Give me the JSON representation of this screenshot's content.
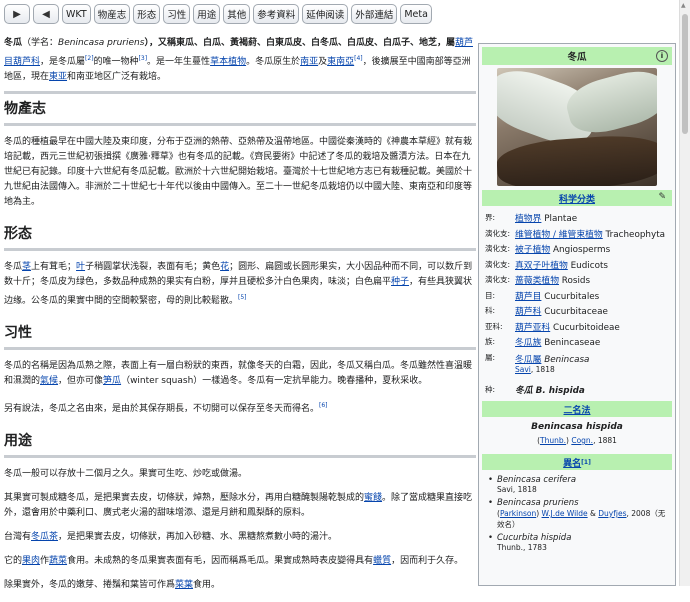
{
  "toolbar": {
    "back_arrow": "▶",
    "fwd_arrow": "◀",
    "buttons": [
      "WKT",
      "物産志",
      "形态",
      "习性",
      "用途",
      "其他",
      "参考資料",
      "延伸阅读",
      "外部連結",
      "Meta"
    ]
  },
  "article": {
    "intro": {
      "title_word": "冬瓜",
      "sci_pre": "（学名：",
      "sci_name": "Benincasa pruriens",
      "aliases": "），又稱東瓜、白瓜、黃褐葤、白東瓜皮、白冬瓜、白瓜皮、白瓜子、地芝，屬",
      "family_link": "葫芦目葫芦科",
      "mid": "，是冬瓜屬",
      "sup1": "[2]",
      "mid2": "的唯一物种",
      "sup2": "[3]",
      "mid3": "。是一年生蔓性",
      "herb_link": "草本植物",
      "mid4": "。冬瓜原生於",
      "sea_link": "南亚",
      "and": "及",
      "sea2_link": "東南亞",
      "sup3": "[4]",
      "mid5": "，後擴展至中國南部等亞洲地區，現在",
      "ea_link": "東亚",
      "end": "和南亚地区广泛有栽培。"
    },
    "sections": [
      {
        "heading": "物產志",
        "paras": [
          "冬瓜的種植最早在中國大陸及東印度，分布于亞洲的熱帶、亞熱帶及溫帶地區。中國從秦漢時的《神農本草經》就有栽培記載，西元三世紀初張揖撰《廣雅·釋草》也有冬瓜的記載。《齊民要術》中記述了冬瓜的栽培及醬漬方法。日本在九世紀已有記錄。印度十六世紀有冬瓜記載。歐洲於十六世紀開始栽培。臺灣於十七世紀地方志已有栽種記載。美國於十九世紀由法國傳入。非洲於二十世紀七十年代以後由中國傳入。至二十一世紀冬瓜栽培仍以中國大陸、東南亞和印度等地為主。"
        ]
      },
      {
        "heading": "形态",
        "p1": "冬瓜",
        "stem": "茎",
        "p2": "上有茸毛；",
        "leaf": "叶",
        "p3": "子稍圓掌状浅裂，表面有毛；黄色",
        "flower": "花",
        "p4": "；圆形、扁圆或长圆形果实，大小因品种而不同，可以数斤到数十斤；冬瓜皮为绿色，多数品种成熟的果实有白粉，厚并且硬松多汁白色果肉，味淡；白色扁平",
        "seed": "种子",
        "p5": "，有些具狭翼状边缘。公冬瓜的果實中間的空間較緊密，母的則比較鬆散。",
        "sup": "[5]"
      },
      {
        "heading": "习性",
        "p1": "冬瓜的名稱是因為瓜熟之際，表面上有一層白粉狀的東西，就像冬天的白霜，因此，冬瓜又稱白瓜。冬瓜雖然性喜溫暖和濕潤的",
        "climate": "氣候",
        "p2": "，但亦可像",
        "squash": "笋瓜",
        "p3": "（winter squash）一樣過冬。冬瓜有一定抗旱能力。晚春播种，夏秋采收。",
        "p4": "另有說法，冬瓜之名由來，是由於其保存期長，不切開可以保存至冬天而得名。",
        "sup": "[6]"
      },
      {
        "heading": "用途",
        "p1": "冬瓜一般可以存放十二個月之久。果實可生吃、炒吃或做湯。",
        "p2a": "其果實可製成糖冬瓜，是把果實去皮，切條狀，焯熟，壓除水分，再用白糖醃製陽乾製成的",
        "candied": "蜜餞",
        "p2b": "。除了當成糖果直接吃外，還會用於中藥利口、廣式老火湯的甜味增添、還是月餅和鳳梨酥的原料。",
        "p3a": "台灣有",
        "tea": "冬瓜茶",
        "p3b": "，是把果實去皮，切條狀，再加入砂糖、水、黑糖熬煮數小時的湯汁。",
        "p4a": "它的",
        "pulp": "果肉",
        "p4b": "作",
        "veg": "蔬菜",
        "p4c": "食用。未成熟的冬瓜果實表面有毛，因而稱爲毛瓜。果實成熟時表皮變得具有",
        "wax": "蠟質",
        "p4d": "，因而利于久存。",
        "p5a": "除果實外，冬瓜的嫩芽、捲鬚和葉皆可作爲",
        "leafveg": "菜葉",
        "p5b": "食用。"
      }
    ]
  },
  "infobox": {
    "title": "冬瓜",
    "info_icon": "i",
    "classification_heading": "科学分类",
    "pencil": "✎",
    "taxonomy": [
      {
        "rank": "界:",
        "link": "植物界",
        "text": " Plantae"
      },
      {
        "rank": "演化支:",
        "link": "维管植物 / 維管束植物",
        "text": " Tracheophyta"
      },
      {
        "rank": "演化支:",
        "link": "被子植物",
        "text": " Angiosperms"
      },
      {
        "rank": "演化支:",
        "link": "真双子叶植物",
        "text": " Eudicots"
      },
      {
        "rank": "演化支:",
        "link": "蔷薇类植物",
        "text": " Rosids"
      },
      {
        "rank": "目:",
        "link": "葫芦目",
        "text": " Cucurbitales"
      },
      {
        "rank": "科:",
        "link": "葫芦科",
        "text": " Cucurbitaceae"
      },
      {
        "rank": "亚科:",
        "link": "葫芦亚科",
        "text": " Cucurbitoideae"
      },
      {
        "rank": "族:",
        "link": "冬瓜族",
        "text": " Benincaseae"
      }
    ],
    "genus": {
      "rank": "屬:",
      "link": "冬瓜屬",
      "text": "Benincasa",
      "author_link": "Savi",
      "year": ", 1818"
    },
    "species": {
      "rank": "种:",
      "text": "冬瓜 B. hispida"
    },
    "binomial_heading": "二名法",
    "binomial_name": "Benincasa hispida",
    "binomial_authority_pre": "(",
    "binomial_author1": "Thunb.",
    "binomial_authority_mid": ") ",
    "binomial_author2": "Cogn.",
    "binomial_year": ", 1881",
    "synonyms_heading": "異名",
    "synonyms_sup": "[1]",
    "synonyms": [
      {
        "name": "Benincasa cerifera",
        "author": "Savi, 1818"
      },
      {
        "name": "Benincasa pruriens",
        "author_pre": "(",
        "author_link1": "Parkinson",
        "author_mid": ") ",
        "author_link2": "W.J.de Wilde",
        "author_and": " & ",
        "author_link3": "Duyfjes",
        "author_post": ", 2008（无效名）"
      },
      {
        "name": "Cucurbita hispida",
        "author": "Thunb., 1783"
      }
    ]
  }
}
